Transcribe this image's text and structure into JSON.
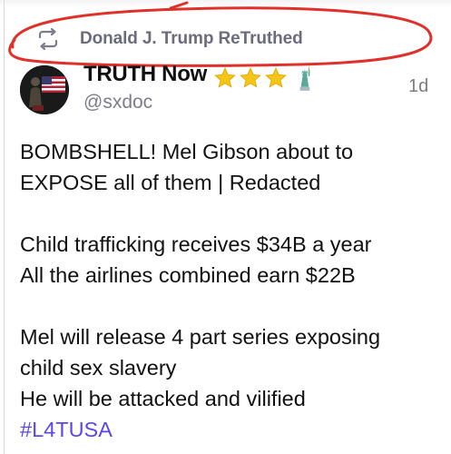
{
  "retruth_banner": {
    "icon": "retruth-icon",
    "text": "Donald J. Trump ReTruthed"
  },
  "post": {
    "author": {
      "display_name": "TRUTH Now",
      "badges": [
        "star-icon",
        "star-icon",
        "star-icon",
        "statue-of-liberty-icon"
      ],
      "handle": "@sxdoc",
      "avatar": "avatar"
    },
    "timestamp": "1d",
    "body_lines": [
      "BOMBSHELL! Mel Gibson about to",
      "EXPOSE all of them | Redacted",
      "Child trafficking receives $34B a year",
      "All the airlines combined earn $22B",
      "Mel will release 4 part series exposing",
      "child sex slavery",
      "He will be attacked and vilified"
    ],
    "hashtag": "#L4TUSA"
  },
  "colors": {
    "annotation_red": "#e0302a",
    "hashtag": "#5a48e8",
    "secondary_text": "#7d7d8a",
    "star": "#f5c518"
  }
}
